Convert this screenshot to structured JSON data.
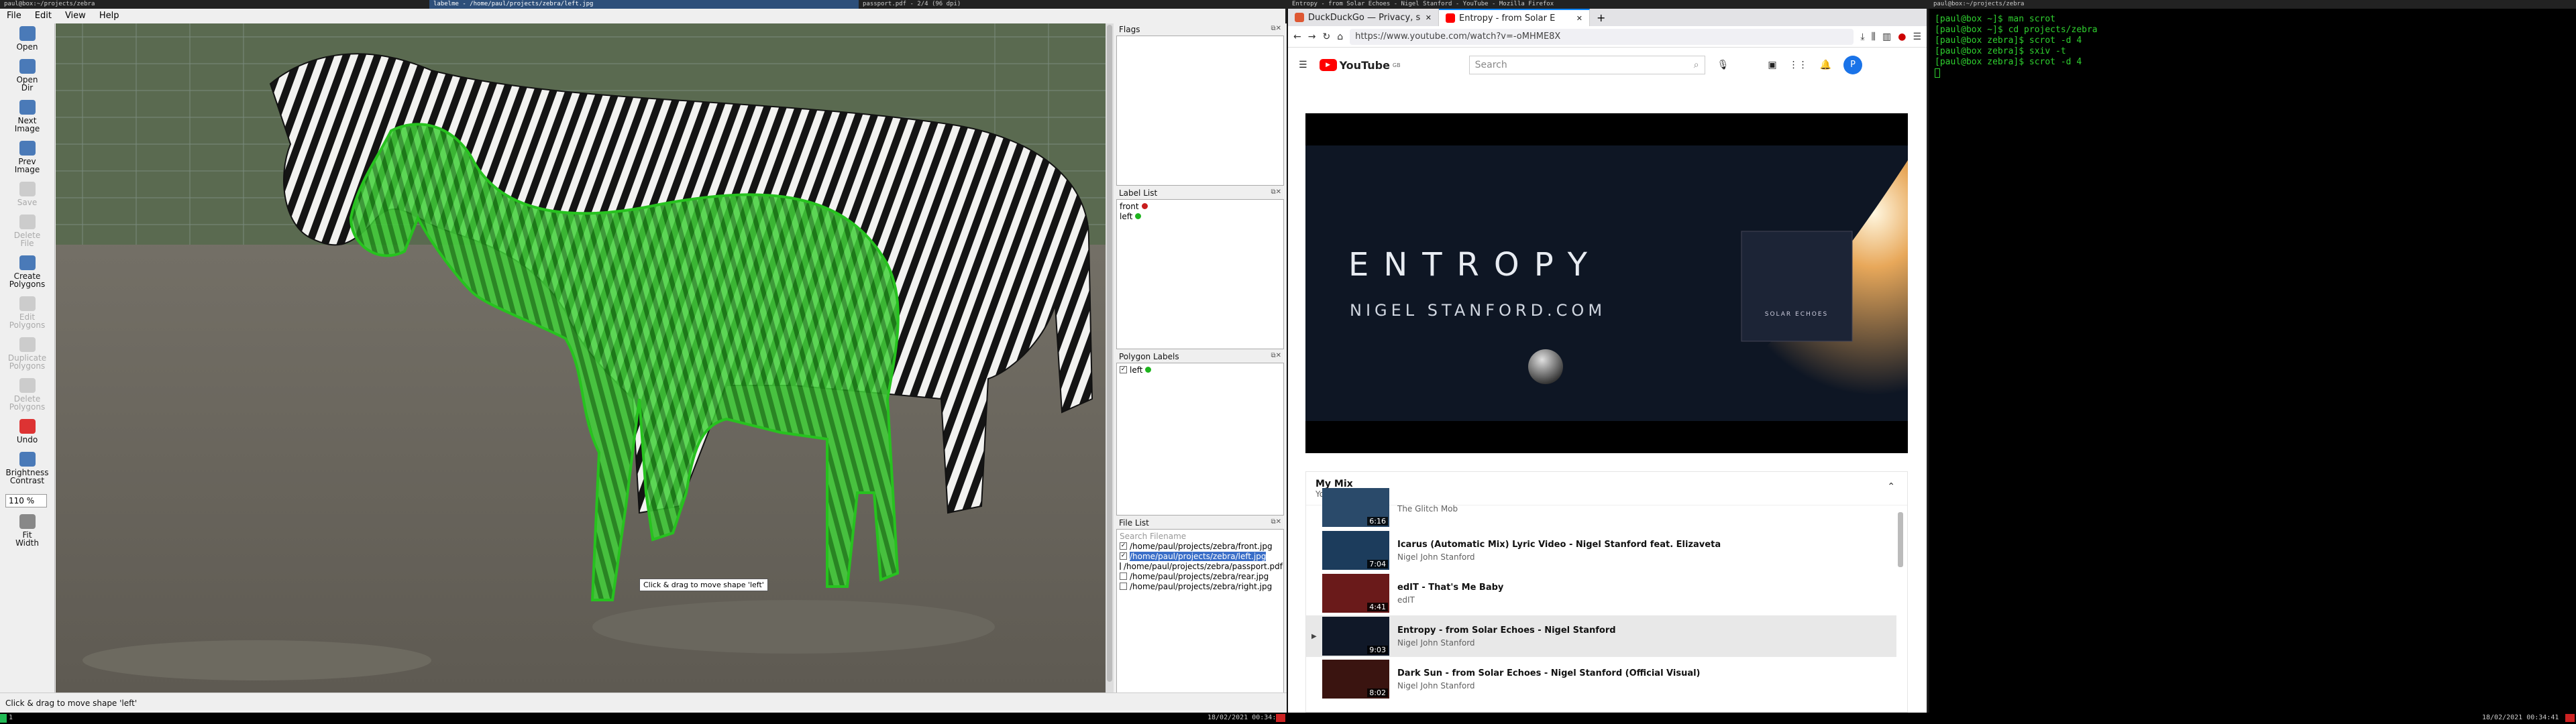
{
  "titles": {
    "left_term": "paul@box:~/projects/zebra",
    "labelme": "labelme - /home/paul/projects/zebra/left.jpg",
    "pdf": "passport.pdf - 2/4 (96 dpi)",
    "firefox": "Entropy - from Solar Echoes - Nigel Stanford - YouTube - Mozilla Firefox",
    "right_term": "paul@box:~/projects/zebra"
  },
  "labelme": {
    "menu": [
      "File",
      "Edit",
      "View",
      "Help"
    ],
    "tools": [
      {
        "label": "Open",
        "icon": "folder-open-icon",
        "enabled": true
      },
      {
        "label": "Open\nDir",
        "icon": "folder-icon",
        "enabled": true
      },
      {
        "label": "Next\nImage",
        "icon": "arrow-right-icon",
        "enabled": true
      },
      {
        "label": "Prev\nImage",
        "icon": "arrow-left-icon",
        "enabled": true
      },
      {
        "label": "Save",
        "icon": "save-icon",
        "enabled": false
      },
      {
        "label": "Delete\nFile",
        "icon": "delete-icon",
        "enabled": false
      },
      {
        "label": "Create\nPolygons",
        "icon": "polygon-create-icon",
        "enabled": true
      },
      {
        "label": "Edit\nPolygons",
        "icon": "edit-icon",
        "enabled": false
      },
      {
        "label": "Duplicate\nPolygons",
        "icon": "copy-icon",
        "enabled": false
      },
      {
        "label": "Delete\nPolygons",
        "icon": "cancel-icon",
        "enabled": false
      },
      {
        "label": "Undo",
        "icon": "undo-icon",
        "enabled": true
      },
      {
        "label": "Brightness\nContrast",
        "icon": "color-icon",
        "enabled": true
      }
    ],
    "zoom": "110 %",
    "fit_width": "Fit\nWidth",
    "flags_title": "Flags",
    "label_list_title": "Label List",
    "labels": [
      {
        "name": "front",
        "color": "#c81e1e"
      },
      {
        "name": "left",
        "color": "#1eb41e"
      }
    ],
    "polygon_labels_title": "Polygon Labels",
    "polygon_labels": [
      {
        "name": "left",
        "color": "#1eb41e",
        "checked": true
      }
    ],
    "file_list_title": "File List",
    "search_placeholder": "Search Filename",
    "files": [
      {
        "path": "/home/paul/projects/zebra/front.jpg",
        "checked": true,
        "selected": false
      },
      {
        "path": "/home/paul/projects/zebra/left.jpg",
        "checked": true,
        "selected": true
      },
      {
        "path": "/home/paul/projects/zebra/passport.pdf",
        "checked": false,
        "selected": false
      },
      {
        "path": "/home/paul/projects/zebra/rear.jpg",
        "checked": false,
        "selected": false
      },
      {
        "path": "/home/paul/projects/zebra/right.jpg",
        "checked": false,
        "selected": false
      }
    ],
    "tooltip": "Click & drag to move shape 'left'",
    "status": "Click & drag to move shape 'left'"
  },
  "firefox": {
    "tabs": [
      {
        "title": "DuckDuckGo — Privacy, s",
        "color": "#de5833",
        "active": false
      },
      {
        "title": "Entropy - from Solar E",
        "color": "#ff0000",
        "active": true
      }
    ],
    "url": "https://www.youtube.com/watch?v=-oMHME8X",
    "yt_logo": "YouTube",
    "yt_country": "GB",
    "search_placeholder": "Search",
    "avatar_letter": "P",
    "player_title": "ENTROPY",
    "player_sub": "NIGEL STANFORD.COM",
    "album_text": "SOLAR ECHOES",
    "mix_title": "My Mix",
    "mix_sub": "YouTube",
    "videos": [
      {
        "title": "",
        "artist": "The Glitch Mob",
        "duration": "6:16",
        "thumb": "#2a4a6a",
        "current": false
      },
      {
        "title": "Icarus (Automatic Mix) Lyric Video - Nigel Stanford feat. Elizaveta",
        "artist": "Nigel John Stanford",
        "duration": "7:04",
        "thumb": "#1c3c5c",
        "current": false
      },
      {
        "title": "edIT - That's Me Baby",
        "artist": "edIT",
        "duration": "4:41",
        "thumb": "#6a1a1a",
        "current": false
      },
      {
        "title": "Entropy - from Solar Echoes - Nigel Stanford",
        "artist": "Nigel John Stanford",
        "duration": "9:03",
        "thumb": "#101828",
        "current": true
      },
      {
        "title": "Dark Sun - from Solar Echoes - Nigel Stanford (Official Visual)",
        "artist": "Nigel John Stanford",
        "duration": "8:02",
        "thumb": "#3a1410",
        "current": false
      }
    ]
  },
  "terminal": {
    "lines": [
      "[paul@box ~]$ man scrot",
      "[paul@box ~]$ cd projects/zebra",
      "[paul@box zebra]$ scrot -d 4",
      "[paul@box zebra]$ sxiv -t",
      "[paul@box zebra]$ scrot -d 4"
    ]
  },
  "panel": {
    "clock_left": "18/02/2021 00:34:41",
    "clock_right": "18/02/2021 00:34:41",
    "workspace": "1"
  }
}
